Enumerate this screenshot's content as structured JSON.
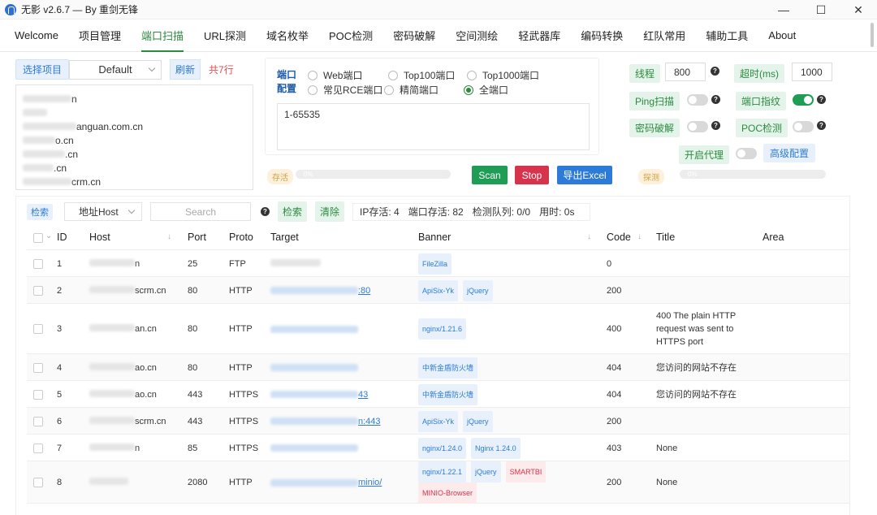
{
  "window": {
    "title": "无影 v2.6.7 — By 重剑无锋",
    "min": "—",
    "max": "☐",
    "close": "✕"
  },
  "menu": [
    "Welcome",
    "项目管理",
    "端口扫描",
    "URL探测",
    "域名枚举",
    "POC检测",
    "密码破解",
    "空间测绘",
    "轻武器库",
    "编码转换",
    "红队常用",
    "辅助工具",
    "About"
  ],
  "menu_active_index": 2,
  "project": {
    "select_btn": "选择项目",
    "current": "Default",
    "refresh": "刷新",
    "count": "共7行"
  },
  "domains": [
    {
      "suffix": "n",
      "w": 60
    },
    {
      "suffix": "",
      "w": 30
    },
    {
      "suffix": "anguan.com.cn",
      "w": 66
    },
    {
      "suffix": "o.cn",
      "w": 40
    },
    {
      "suffix": ".cn",
      "w": 52
    },
    {
      "suffix": ".cn",
      "w": 38
    },
    {
      "suffix": "crm.cn",
      "w": 60
    }
  ],
  "port_config": {
    "label_port": "端口",
    "label_config": "配置",
    "options": [
      {
        "label": "Web端口",
        "on": false
      },
      {
        "label": "Top100端口",
        "on": false
      },
      {
        "label": "Top1000端口",
        "on": false
      },
      {
        "label": "常见RCE端口",
        "on": false
      },
      {
        "label": "精简端口",
        "on": false
      },
      {
        "label": "全端口",
        "on": true
      }
    ],
    "ports_value": "1-65535"
  },
  "progress": {
    "alive_label": "存活",
    "detect_label": "探测",
    "alive_pct": "0%",
    "detect_pct": "0%"
  },
  "actions": {
    "scan": "Scan",
    "stop": "Stop",
    "export": "导出Excel"
  },
  "settings": {
    "threads_label": "线程",
    "threads_value": "800",
    "timeout_label": "超时(ms)",
    "timeout_value": "1000",
    "ping_label": "Ping扫描",
    "ping_on": false,
    "fingerprint_label": "端口指纹",
    "fingerprint_on": true,
    "brute_label": "密码破解",
    "brute_on": false,
    "poc_label": "POC检测",
    "poc_on": false,
    "proxy_label": "开启代理",
    "proxy_on": false,
    "advanced_label": "高级配置",
    "help": "?"
  },
  "filter": {
    "search_btn_small": "检索",
    "field": "地址Host",
    "search_placeholder": "Search",
    "help": "?",
    "search_btn": "检索",
    "clear_btn": "清除",
    "ip_alive": "IP存活: 4",
    "port_alive": "端口存活: 82",
    "queue": "检测队列: 0/0",
    "elapsed": "用时: 0s"
  },
  "table": {
    "columns": [
      "ID",
      "Host",
      "Port",
      "Proto",
      "Target",
      "Banner",
      "Code",
      "Title",
      "Area"
    ],
    "rows": [
      {
        "id": "1",
        "host": "n",
        "port": "25",
        "proto": "FTP",
        "target": "",
        "banners": [
          {
            "t": "FileZilla",
            "c": "blue"
          }
        ],
        "code": "0",
        "title": ""
      },
      {
        "id": "2",
        "host": "scrm.cn",
        "port": "80",
        "proto": "HTTP",
        "target": ":80",
        "banners": [
          {
            "t": "ApiSix-Yk",
            "c": "blue"
          },
          {
            "t": "jQuery",
            "c": "blue"
          }
        ],
        "code": "200",
        "title": ""
      },
      {
        "id": "3",
        "host": "an.cn",
        "port": "80",
        "proto": "HTTP",
        "target": "",
        "banners": [
          {
            "t": "nginx/1.21.6",
            "c": "blue"
          }
        ],
        "code": "400",
        "title": "400 The plain HTTP request was sent to HTTPS port"
      },
      {
        "id": "4",
        "host": "ao.cn",
        "port": "80",
        "proto": "HTTP",
        "target": "",
        "banners": [
          {
            "t": "中新金盾防火墙",
            "c": "blue"
          }
        ],
        "code": "404",
        "title": "您访问的网站不存在"
      },
      {
        "id": "5",
        "host": "ao.cn",
        "port": "443",
        "proto": "HTTPS",
        "target": "43",
        "banners": [
          {
            "t": "中新金盾防火墙",
            "c": "blue"
          }
        ],
        "code": "404",
        "title": "您访问的网站不存在"
      },
      {
        "id": "6",
        "host": "scrm.cn",
        "port": "443",
        "proto": "HTTPS",
        "target": "n:443",
        "banners": [
          {
            "t": "ApiSix-Yk",
            "c": "blue"
          },
          {
            "t": "jQuery",
            "c": "blue"
          }
        ],
        "code": "200",
        "title": ""
      },
      {
        "id": "7",
        "host": "n",
        "port": "85",
        "proto": "HTTPS",
        "target": "",
        "banners": [
          {
            "t": "nginx/1.24.0",
            "c": "blue"
          },
          {
            "t": "Nginx 1.24.0",
            "c": "blue"
          }
        ],
        "code": "403",
        "title": "None"
      },
      {
        "id": "8",
        "host": "",
        "port": "2080",
        "proto": "HTTP",
        "target": "minio/",
        "banners": [
          {
            "t": "nginx/1.22.1",
            "c": "blue"
          },
          {
            "t": "jQuery",
            "c": "blue"
          },
          {
            "t": "SMARTBI",
            "c": "red"
          },
          {
            "t": "MINIO-Browser",
            "c": "red"
          }
        ],
        "code": "200",
        "title": "None"
      }
    ]
  }
}
